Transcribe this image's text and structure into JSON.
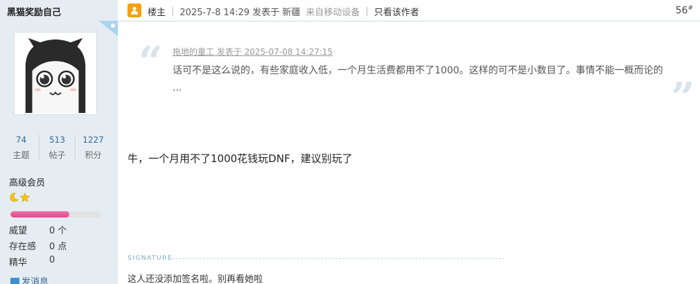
{
  "user": {
    "name": "黑猫奖励自己",
    "stats": [
      {
        "value": "74",
        "label": "主题"
      },
      {
        "value": "513",
        "label": "帖子"
      },
      {
        "value": "1227",
        "label": "积分"
      }
    ],
    "rank": "高级会员",
    "rank_icons": [
      "moon-icon",
      "star-icon"
    ],
    "exp_progress": 0.65,
    "meta": [
      {
        "label": "威望",
        "value": "0 个"
      },
      {
        "label": "存在感",
        "value": "0 点"
      },
      {
        "label": "精华",
        "value": "0"
      }
    ],
    "send_message": "发消息"
  },
  "header": {
    "floor_label": "楼主",
    "posted_time": "2025-7-8 14:29 发表于 新疆",
    "from_device": "来自移动设备",
    "only_author": "只看该作者",
    "floor_number": "56",
    "floor_sup": "#"
  },
  "quote": {
    "header": "拖地的童工 发表于 2025-07-08 14:27:15",
    "body": "话可不是这么说的，有些家庭收入低，一个月生活费都用不了1000。这样的可不是小数目了。事情不能一概而论的 ..."
  },
  "post": {
    "body": "牛，一个月用不了1000花钱玩DNF，建议别玩了"
  },
  "signature": {
    "label": "SIGNATURE",
    "text": "这人还没添加签名啦。别再看她啦"
  },
  "colors": {
    "sidebar_bg": "#e5edf2",
    "link": "#336699",
    "badge": "#f3a112",
    "exp_bar": "#e14b8d"
  }
}
